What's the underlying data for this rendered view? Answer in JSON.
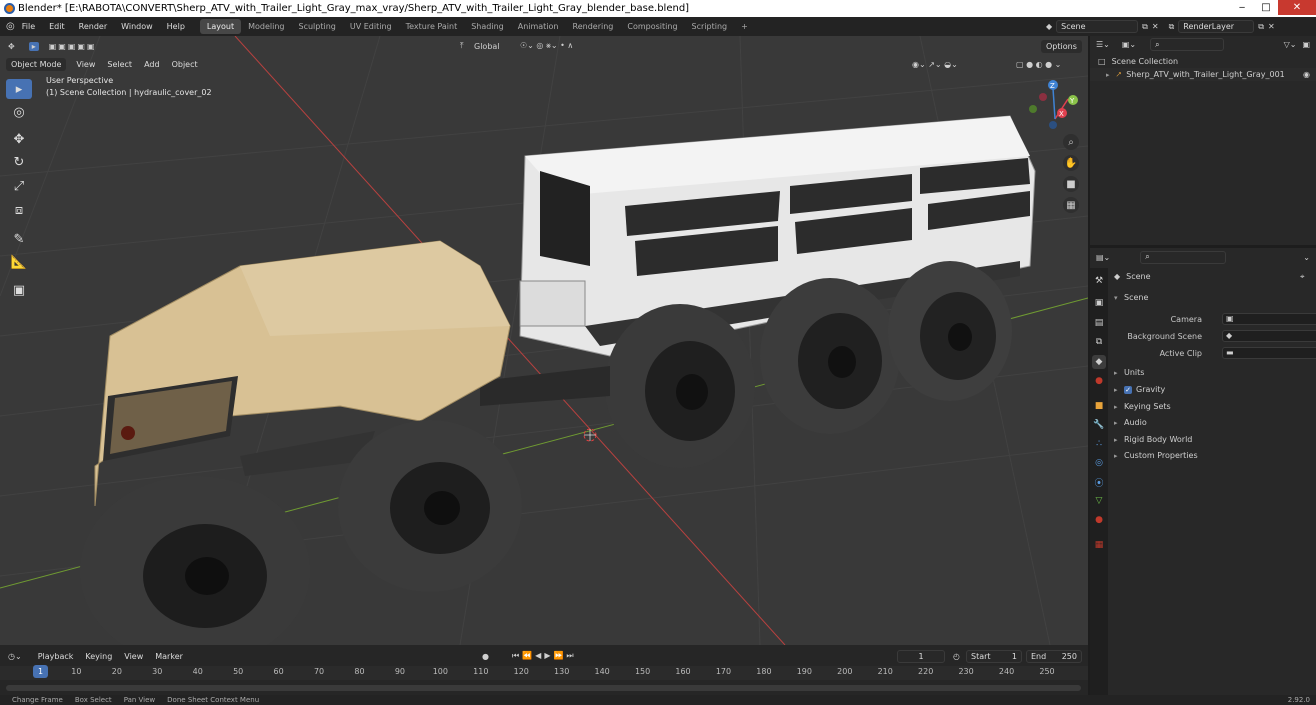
{
  "window": {
    "title": "Blender* [E:\\RABOTA\\CONVERT\\Sherp_ATV_with_Trailer_Light_Gray_max_vray/Sherp_ATV_with_Trailer_Light_Gray_blender_base.blend]",
    "min": "‒",
    "max": "□",
    "close": "✕"
  },
  "menubar": {
    "items": [
      "File",
      "Edit",
      "Render",
      "Window",
      "Help"
    ],
    "workspaces": [
      "Layout",
      "Modeling",
      "Sculpting",
      "UV Editing",
      "Texture Paint",
      "Shading",
      "Animation",
      "Rendering",
      "Compositing",
      "Scripting"
    ],
    "active_workspace": "Layout",
    "add_workspace": "+",
    "scene": "Scene",
    "view_layer": "RenderLayer"
  },
  "viewport": {
    "mode": "Object Mode",
    "menus": [
      "View",
      "Select",
      "Add",
      "Object"
    ],
    "transform_orientation": "Global",
    "options": "Options",
    "overlay_title": "User Perspective",
    "overlay_subtitle": "(1) Scene Collection | hydraulic_cover_02",
    "tools": [
      "select-box",
      "cursor",
      "move",
      "rotate",
      "scale",
      "transform",
      "annotate",
      "measure",
      "add-cube"
    ],
    "gizmo": {
      "x": "X",
      "y": "Y",
      "z": "Z"
    },
    "nav": [
      "zoom-icon",
      "hand-icon",
      "camera-icon",
      "grid-icon"
    ]
  },
  "timeline": {
    "menus": [
      "Playback",
      "Keying",
      "View",
      "Marker"
    ],
    "current_frame": "1",
    "start_label": "Start",
    "start": "1",
    "end_label": "End",
    "end": "250",
    "ticks": [
      "1",
      "10",
      "20",
      "30",
      "40",
      "50",
      "60",
      "70",
      "80",
      "90",
      "100",
      "110",
      "120",
      "130",
      "140",
      "150",
      "160",
      "170",
      "180",
      "190",
      "200",
      "210",
      "220",
      "230",
      "240",
      "250"
    ]
  },
  "statusbar": {
    "items": [
      "Change Frame",
      "Box Select",
      "Pan View",
      "Done Sheet Context Menu"
    ],
    "version": "2.92.0"
  },
  "outliner": {
    "root": "Scene Collection",
    "items": [
      {
        "label": "Sherp_ATV_with_Trailer_Light_Gray_001"
      }
    ]
  },
  "properties": {
    "context": "Scene",
    "panel": "Scene",
    "fields": [
      {
        "label": "Camera"
      },
      {
        "label": "Background Scene"
      },
      {
        "label": "Active Clip"
      }
    ],
    "sections": [
      "Units",
      "Gravity",
      "Keying Sets",
      "Audio",
      "Rigid Body World",
      "Custom Properties"
    ],
    "gravity_checked": true
  },
  "colors": {
    "accent": "#4772b3",
    "viewport_bg": "#393939",
    "x_axis": "#e0404f",
    "y_axis": "#8bc34a",
    "z_axis": "#3f83d4"
  }
}
